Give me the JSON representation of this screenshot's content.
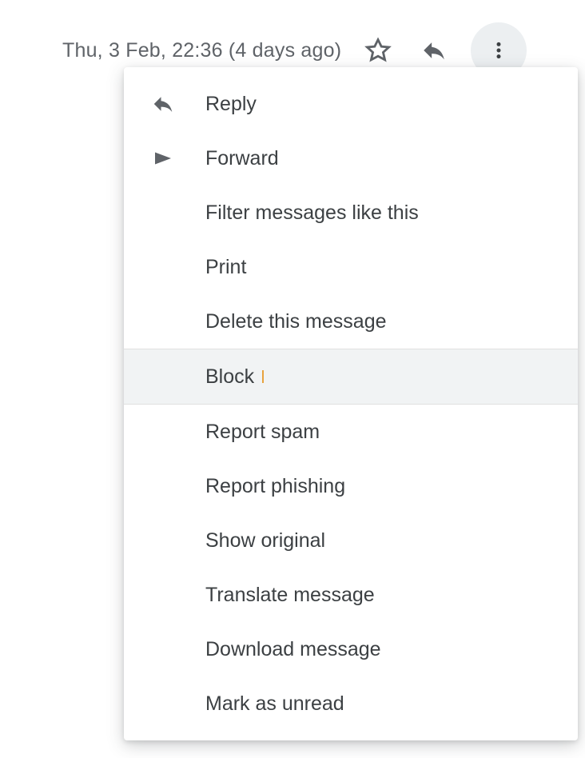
{
  "header": {
    "timestamp": "Thu, 3 Feb, 22:36 (4 days ago)"
  },
  "menu": {
    "reply": "Reply",
    "forward": "Forward",
    "filter": "Filter messages like this",
    "print": "Print",
    "delete": "Delete this message",
    "block": "Block",
    "report_spam": "Report spam",
    "report_phishing": "Report phishing",
    "show_original": "Show original",
    "translate": "Translate message",
    "download": "Download message",
    "mark_unread": "Mark as unread"
  }
}
